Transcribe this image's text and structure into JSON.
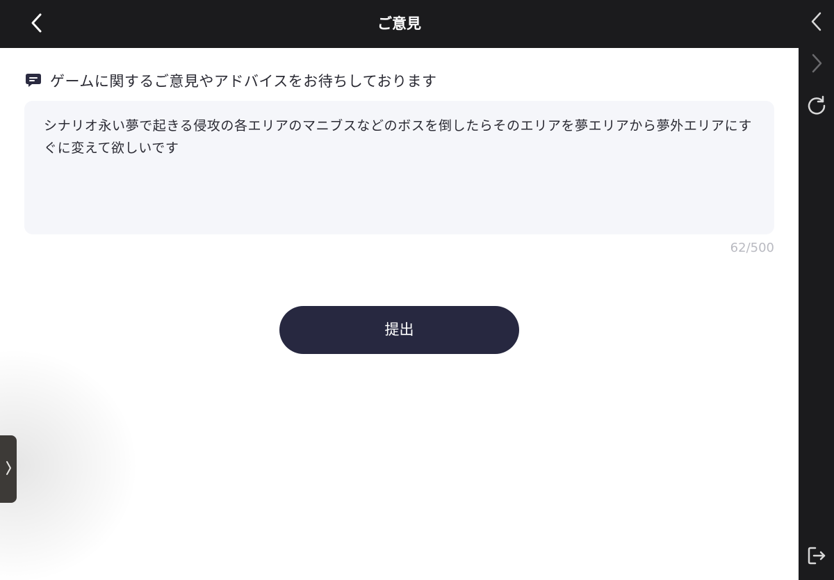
{
  "header": {
    "title": "ご意見",
    "back_icon": "chevron-left-icon"
  },
  "feedback": {
    "heading_icon": "message-icon",
    "heading": "ゲームに関するご意見やアドバイスをお待ちしております",
    "text": "シナリオ永い夢で起きる侵攻の各エリアのマニブスなどのボスを倒したらそのエリアを夢エリアから夢外エリアにすぐに変えて欲しいです",
    "counter": "62/500"
  },
  "submit": {
    "label": "提出"
  },
  "side_tab": {
    "icon": "chevron-right-icon"
  },
  "browser_rail": {
    "buttons": [
      "chevron-left-icon",
      "chevron-right-icon",
      "refresh-icon",
      "exit-icon"
    ]
  },
  "colors": {
    "topbar": "#1b1b1d",
    "button": "#272840",
    "input_bg": "#f5f6fa",
    "counter": "#b9bac1"
  }
}
